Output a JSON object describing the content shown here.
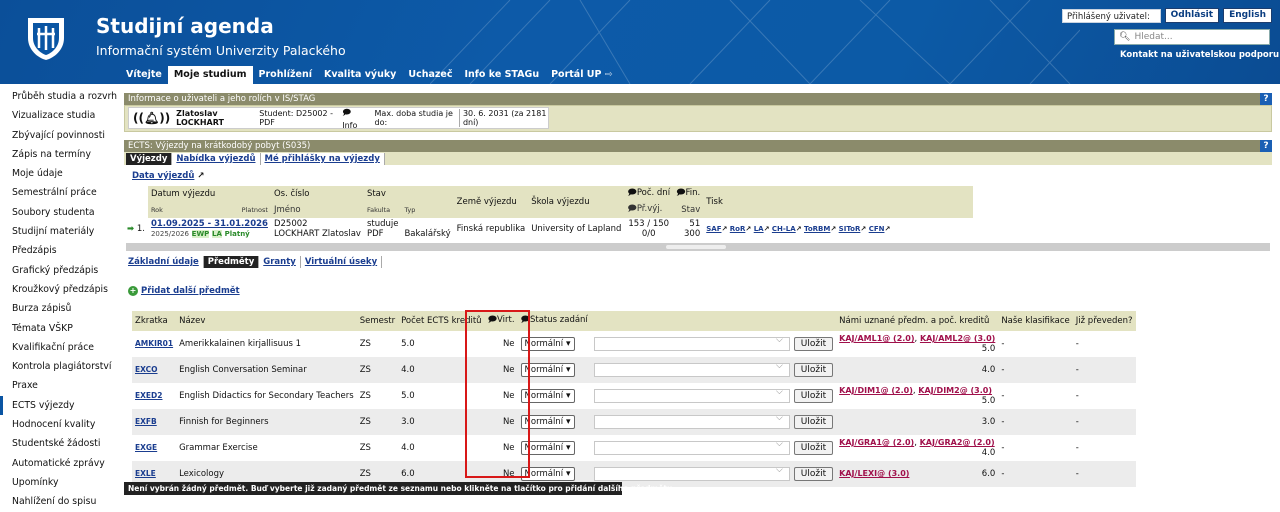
{
  "header": {
    "title": "Studijní agenda",
    "subtitle": "Informační systém Univerzity Palackého",
    "user_label": "Přihlášený uživatel:",
    "logout": "Odhlásit",
    "lang": "English",
    "search_placeholder": "Hledat...",
    "support": "Kontakt na uživatelskou podporu",
    "nav": [
      "Vítejte",
      "Moje studium",
      "Prohlížení",
      "Kvalita výuky",
      "Uchazeč",
      "Info ke STAGu",
      "Portál UP"
    ]
  },
  "sidebar": [
    "Průběh studia a rozvrh",
    "Vizualizace studia",
    "Zbývající povinnosti",
    "Zápis na termíny",
    "Moje údaje",
    "Semestrální práce",
    "Soubory studenta",
    "Studijní materiály",
    "Předzápis",
    "Grafický předzápis",
    "Kroužkový předzápis",
    "Burza zápisů",
    "Témata VŠKP",
    "Kvalifikační práce",
    "Kontrola plagiátorství",
    "Praxe",
    "ECTS výjezdy",
    "Hodnocení kvality",
    "Studentské žádosti",
    "Automatické zprávy",
    "Upomínky",
    "Nahlížení do spisu"
  ],
  "user_info": {
    "header": "Informace o uživateli a jeho rolích v IS/STAG",
    "name": "Zlatoslav LOCKHART",
    "student": "Student: D25002 - PDF",
    "info": "Info",
    "max": "Max. doba studia je do:",
    "max_date": "30. 6. 2031 (za 2181 dní)"
  },
  "ects": {
    "header": "ECTS: Výjezdy na krátkodobý pobyt (S035)",
    "tabs": [
      "Výjezdy",
      "Nabídka výjezdů",
      "Mé přihlášky na výjezdy"
    ],
    "data_link": "Data výjezdů",
    "cols": {
      "datum": "Datum výjezdu",
      "rok": "Rok",
      "platnost": "Platnost",
      "os": "Os. číslo",
      "jmeno": "Jméno",
      "stav": "Stav",
      "fakulta": "Fakulta",
      "typ": "Typ",
      "zeme": "Země výjezdu",
      "skola": "Škola výjezdu",
      "poc": "Poč. dní",
      "prvyj": "Př.výj.",
      "fin": "Fin.",
      "stav2": "Stav",
      "tisk": "Tisk"
    },
    "row": {
      "num": "1.",
      "date": "01.09.2025 - 31.01.2026",
      "year": "2025/2026",
      "b1": "EWP",
      "b2": "LA",
      "platny": "Platný",
      "os": "D25002",
      "name": "LOCKHART Zlatoslav",
      "stav": "studuje",
      "fak": "PDF",
      "typ": "Bakalářský",
      "zeme": "Finská republika",
      "skola": "University of Lapland",
      "dni": "153 / 150",
      "pr": "0/0",
      "fin1": "51",
      "fin2": "300",
      "tisk": [
        "SAF",
        "RoR",
        "LA",
        "CH-LA",
        "ToRBM",
        "SIToR",
        "CFN"
      ]
    }
  },
  "subtabs": [
    "Základní údaje",
    "Předměty",
    "Granty",
    "Virtuální úseky"
  ],
  "add_subject": "Přidat další předmět",
  "subjects": {
    "headers": [
      "Zkratka",
      "Název",
      "Semestr",
      "Počet ECTS kreditů",
      "Virt.",
      "Status zadání",
      "",
      "Námi uznané předm. a poč. kreditů",
      "Naše klasifikace",
      "Již převeden?"
    ],
    "rows": [
      {
        "code": "AMKIR01",
        "name": "Amerikkalainen kirjallisuus 1",
        "sem": "ZS",
        "ects": "5.0",
        "virt": "Ne",
        "status": "Normální",
        "save": "Uložit",
        "kaj": [
          "KAJ/AML1@ (2.0)",
          "KAJ/AML2@ (3.0)"
        ],
        "kred": "5.0",
        "klas": "-",
        "prev": "-"
      },
      {
        "code": "EXCO",
        "name": "English Conversation Seminar",
        "sem": "ZS",
        "ects": "4.0",
        "virt": "Ne",
        "status": "Normální",
        "save": "Uložit",
        "kaj": [],
        "kred": "4.0",
        "klas": "-",
        "prev": "-"
      },
      {
        "code": "EXED2",
        "name": "English Didactics for Secondary Teachers",
        "sem": "ZS",
        "ects": "5.0",
        "virt": "Ne",
        "status": "Normální",
        "save": "Uložit",
        "kaj": [
          "KAJ/DIM1@ (2.0)",
          "KAJ/DIM2@ (3.0)"
        ],
        "kred": "5.0",
        "klas": "-",
        "prev": "-"
      },
      {
        "code": "EXFB",
        "name": "Finnish for Beginners",
        "sem": "ZS",
        "ects": "3.0",
        "virt": "Ne",
        "status": "Normální",
        "save": "Uložit",
        "kaj": [],
        "kred": "3.0",
        "klas": "-",
        "prev": "-"
      },
      {
        "code": "EXGE",
        "name": "Grammar Exercise",
        "sem": "ZS",
        "ects": "4.0",
        "virt": "Ne",
        "status": "Normální",
        "save": "Uložit",
        "kaj": [
          "KAJ/GRA1@ (2.0)",
          "KAJ/GRA2@ (2.0)"
        ],
        "kred": "4.0",
        "klas": "-",
        "prev": "-"
      },
      {
        "code": "EXLE",
        "name": "Lexicology",
        "sem": "ZS",
        "ects": "6.0",
        "virt": "Ne",
        "status": "Normální",
        "save": "Uložit",
        "kaj": [
          "KAJ/LEXI@ (3.0)"
        ],
        "kred": "6.0",
        "klas": "-",
        "prev": "-"
      }
    ]
  },
  "footer": "Není vybrán žádný předmět. Buď vyberte již zadaný předmět ze seznamu nebo klikněte na tlačítko pro přidání dalšího předmětu."
}
